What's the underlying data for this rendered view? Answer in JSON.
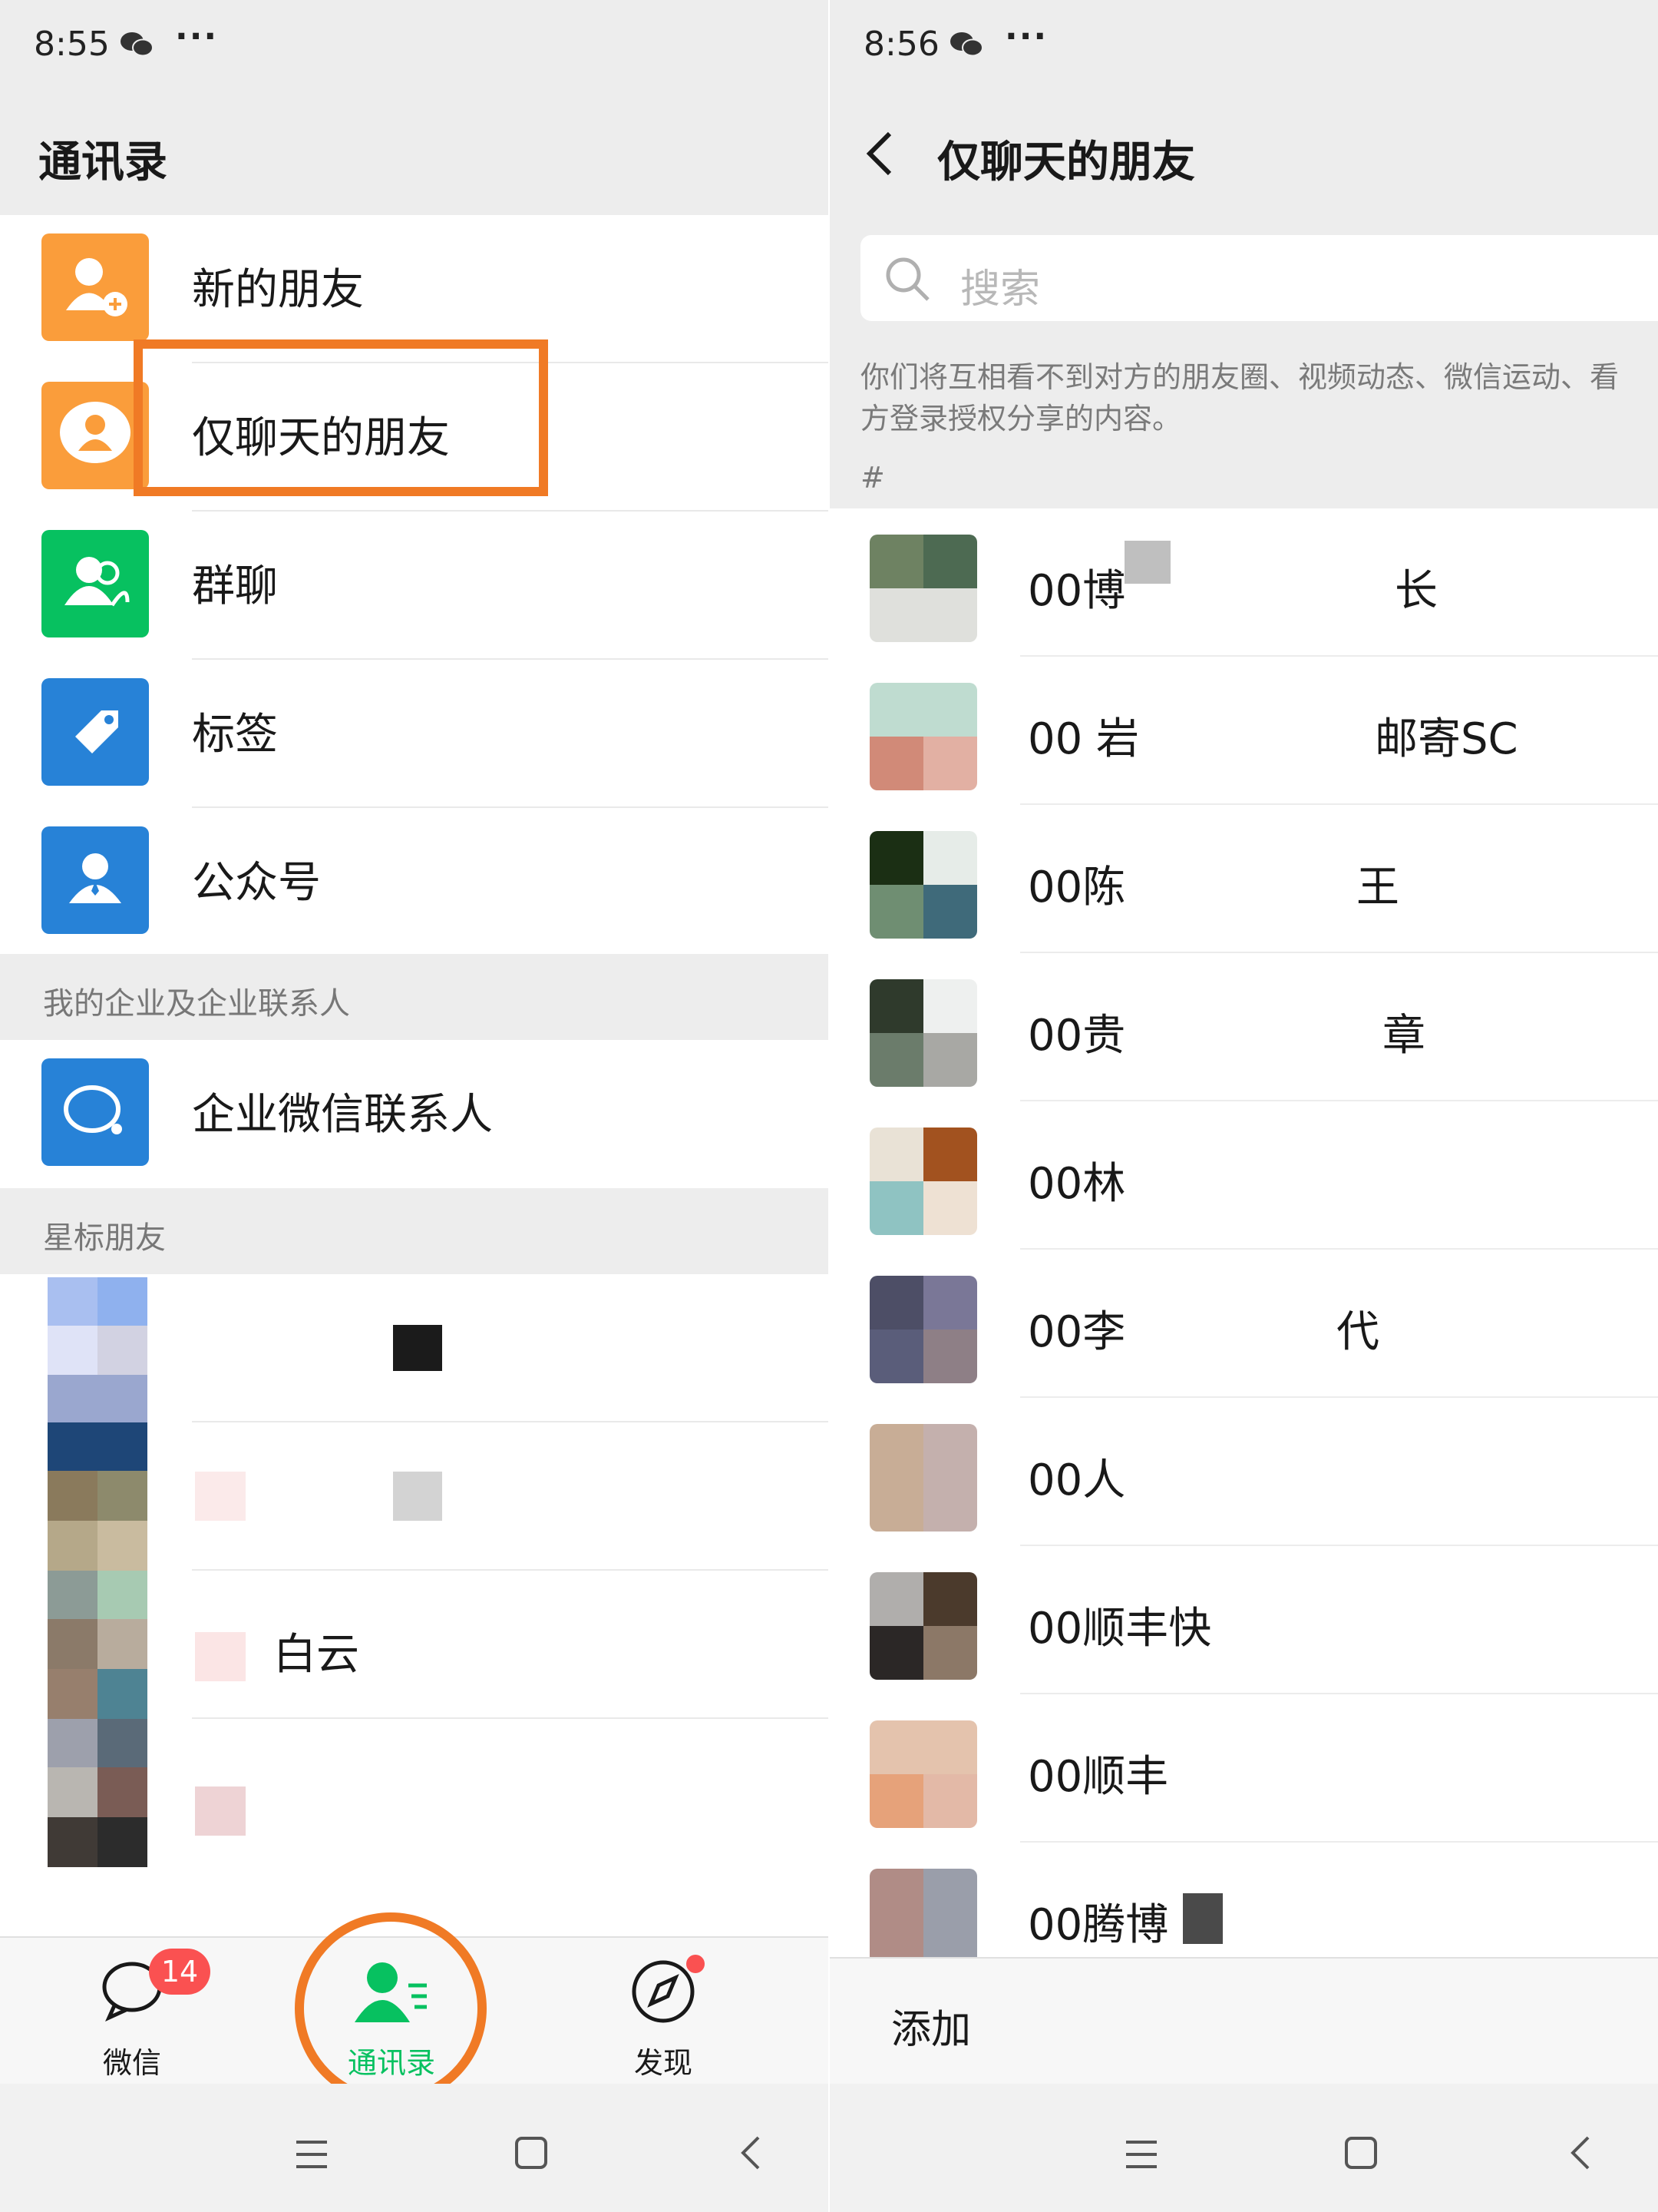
{
  "left": {
    "status": {
      "time": "8:55",
      "icon": "wechat-icon",
      "more": "···"
    },
    "title": "通讯录",
    "menu": [
      {
        "label": "新的朋友",
        "icon": "add-friend-icon",
        "color": "#fa9d3b"
      },
      {
        "label": "仅聊天的朋友",
        "icon": "chat-only-friend-icon",
        "color": "#fa9d3b"
      },
      {
        "label": "群聊",
        "icon": "group-chat-icon",
        "color": "#07c160"
      },
      {
        "label": "标签",
        "icon": "tag-icon",
        "color": "#2782d7"
      },
      {
        "label": "公众号",
        "icon": "official-account-icon",
        "color": "#2782d7"
      }
    ],
    "section_enterprise": "我的企业及企业联系人",
    "enterprise_item": {
      "label": "企业微信联系人",
      "icon": "wecom-contacts-icon",
      "color": "#2782d7"
    },
    "section_starred": "星标朋友",
    "starred": [
      {
        "label": ""
      },
      {
        "label": ""
      },
      {
        "label": "白云"
      },
      {
        "label": ""
      }
    ],
    "tabs": [
      {
        "label": "微信",
        "icon": "chat-bubble-icon",
        "badge": "14"
      },
      {
        "label": "通讯录",
        "icon": "contacts-icon",
        "active": true
      },
      {
        "label": "发现",
        "icon": "compass-icon"
      }
    ],
    "accent": "#07c160",
    "highlight_color": "#f07a25"
  },
  "right": {
    "status": {
      "time": "8:56",
      "icon": "wechat-icon",
      "more": "···"
    },
    "title": "仅聊天的朋友",
    "search_placeholder": "搜索",
    "notice": "你们将互相看不到对方的朋友圈、视频动态、微信运动、看一看等，以及对方登录授权分享的内容。",
    "notice_line1": "你们将互相看不到对方的朋友圈、视频动态、微信运动、看",
    "notice_line2": "方登录授权分享的内容。",
    "section_hash": "#",
    "contacts": [
      {
        "name": "00博",
        "tail": "长"
      },
      {
        "name": "00 岩",
        "tail": "邮寄SC"
      },
      {
        "name": "00陈",
        "tail": "王"
      },
      {
        "name": "00贵",
        "tail": "章"
      },
      {
        "name": "00林",
        "tail": ""
      },
      {
        "name": "00李",
        "tail": "代"
      },
      {
        "name": "00人",
        "tail": ""
      },
      {
        "name": "00顺丰快",
        "tail": ""
      },
      {
        "name": "00顺丰",
        "tail": ""
      },
      {
        "name": "00腾博",
        "tail": ""
      }
    ],
    "add_label": "添加"
  }
}
